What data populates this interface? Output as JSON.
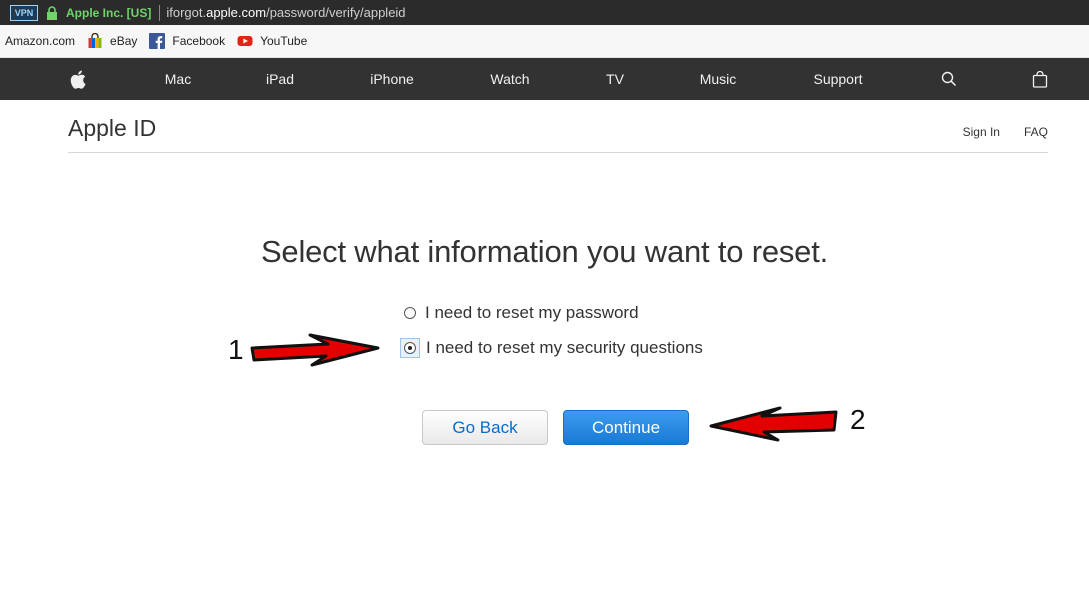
{
  "browser": {
    "vpn_badge": "VPN",
    "organization": "Apple Inc. [US]",
    "url_prefix": "iforgot.",
    "url_domain": "apple.com",
    "url_path": "/password/verify/appleid"
  },
  "bookmarks": [
    {
      "label": "Amazon.com",
      "icon": "none"
    },
    {
      "label": "eBay",
      "icon": "ebay-bag-icon"
    },
    {
      "label": "Facebook",
      "icon": "facebook-icon"
    },
    {
      "label": "YouTube",
      "icon": "youtube-icon"
    }
  ],
  "nav": {
    "items": [
      "Mac",
      "iPad",
      "iPhone",
      "Watch",
      "TV",
      "Music",
      "Support"
    ],
    "icons": [
      "apple-logo-icon",
      "search-icon",
      "bag-icon"
    ]
  },
  "apple_id": {
    "title": "Apple ID",
    "sign_in": "Sign In",
    "faq": "FAQ"
  },
  "main": {
    "headline": "Select what information you want to reset.",
    "options": [
      {
        "label": "I need to reset my password",
        "selected": false
      },
      {
        "label": "I need to reset my security questions",
        "selected": true
      }
    ],
    "go_back": "Go Back",
    "continue": "Continue"
  },
  "annotations": {
    "step1": "1",
    "step2": "2",
    "arrow_color": "#e30000"
  },
  "colors": {
    "nav_bg": "#323232",
    "link_blue": "#0a6bc9",
    "primary_button": "#1a79d4"
  }
}
